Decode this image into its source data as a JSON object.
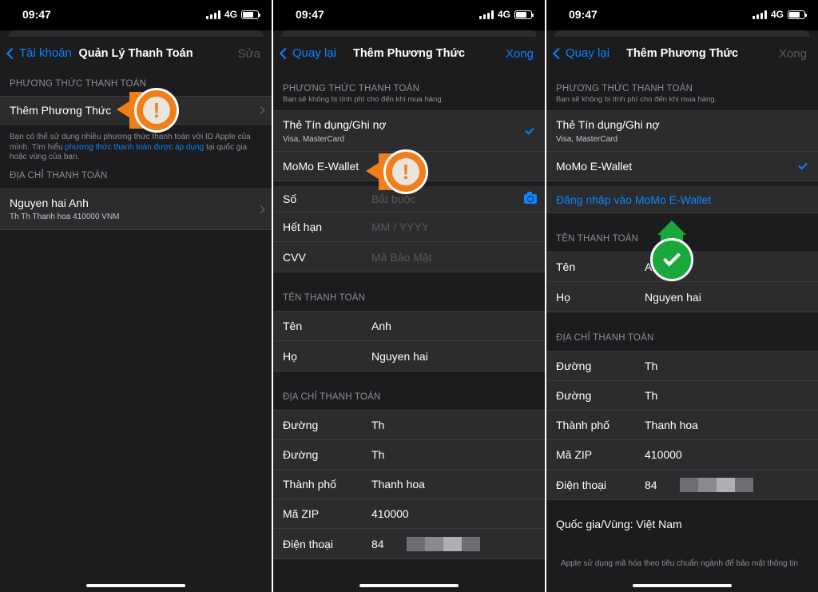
{
  "status": {
    "time": "09:47",
    "network": "4G"
  },
  "screen1": {
    "nav": {
      "back": "Tài khoản",
      "title": "Quản Lý Thanh Toán",
      "action": "Sửa"
    },
    "payment_header": "PHƯƠNG THỨC THANH TOÁN",
    "add_method": "Thêm Phương Thức",
    "info_text_1": "Bạn có thể sử dụng nhiều phương thức thanh toán với ID Apple của mình. Tìm hiểu ",
    "info_link": "phương thức thanh toán được áp dụng",
    "info_text_2": " tại quốc gia hoặc vùng của bạn.",
    "address_header": "ĐỊA CHỈ THANH TOÁN",
    "address_name": "Nguyen hai Anh",
    "address_line": "Th Th Thanh hoa 410000 VNM"
  },
  "screen2": {
    "nav": {
      "back": "Quay lại",
      "title": "Thêm Phương Thức",
      "action": "Xong"
    },
    "payment_header": "PHƯƠNG THỨC THANH TOÁN",
    "payment_sub": "Bạn sẽ không bị tính phí cho đến khi mua hàng.",
    "card_title": "Thẻ Tín dụng/Ghi nợ",
    "card_sub": "Visa, MasterCard",
    "momo": "MoMo E-Wallet",
    "number_label": "Số",
    "number_ph": "Bắt buộc",
    "expiry_label": "Hết hạn",
    "expiry_ph": "MM  /  YYYY",
    "cvv_label": "CVV",
    "cvv_ph": "Mã Bảo Mật",
    "name_header": "TÊN THANH TOÁN",
    "first_label": "Tên",
    "first_value": "Anh",
    "last_label": "Họ",
    "last_value": "Nguyen hai",
    "address_header": "ĐỊA CHỈ THANH TOÁN",
    "street_label": "Đường",
    "street1": "Th",
    "street2": "Th",
    "city_label": "Thành phố",
    "city": "Thanh hoa",
    "zip_label": "Mã ZIP",
    "zip": "410000",
    "phone_label": "Điện thoại",
    "phone_code": "84"
  },
  "screen3": {
    "nav": {
      "back": "Quay lại",
      "title": "Thêm Phương Thức",
      "action": "Xong"
    },
    "payment_header": "PHƯƠNG THỨC THANH TOÁN",
    "payment_sub": "Bạn sẽ không bị tính phí cho đến khi mua hàng.",
    "card_title": "Thẻ Tín dụng/Ghi nợ",
    "card_sub": "Visa, MasterCard",
    "momo": "MoMo E-Wallet",
    "login_link": "Đăng nhập vào MoMo E-Wallet",
    "name_header": "TÊN THANH TOÁN",
    "first_label": "Tên",
    "first_value": "Anh",
    "last_label": "Họ",
    "last_value": "Nguyen hai",
    "address_header": "ĐỊA CHỈ THANH TOÁN",
    "street_label": "Đường",
    "street1": "Th",
    "street2": "Th",
    "city_label": "Thành phố",
    "city": "Thanh hoa",
    "zip_label": "Mã ZIP",
    "zip": "410000",
    "phone_label": "Điện thoại",
    "phone_code": "84",
    "country": "Quốc gia/Vùng: Việt Nam",
    "footer": "Apple sử dụng mã hóa theo tiêu chuẩn ngành để bảo mật thông tin"
  },
  "colors": {
    "accent": "#0a84ff",
    "callout": "#f07f1a",
    "success": "#1aa83c",
    "background": "#1c1c1e",
    "cell": "#2c2c2e"
  }
}
